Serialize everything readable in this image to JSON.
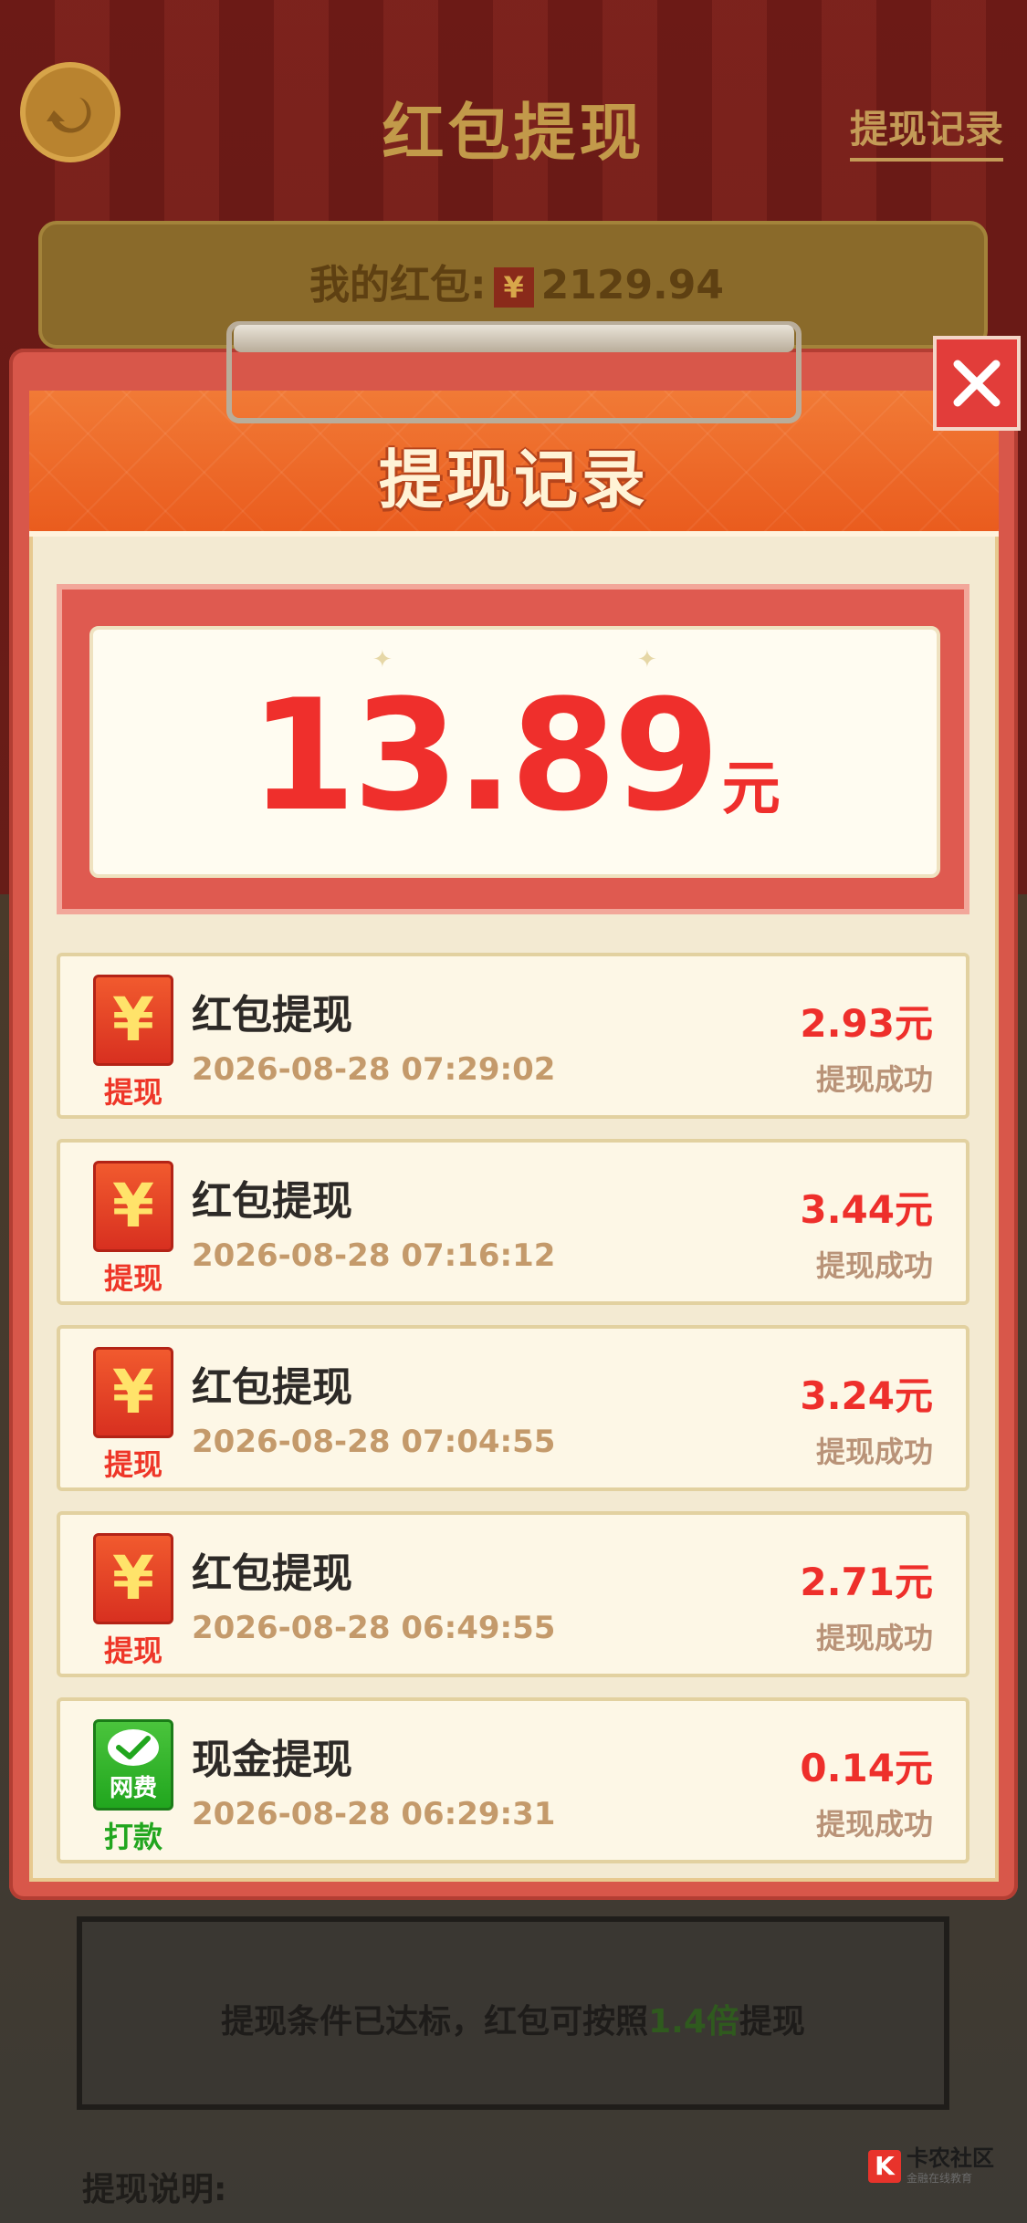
{
  "header": {
    "title": "红包提现",
    "record_link": "提现记录"
  },
  "wallet": {
    "label": "我的红包:",
    "currency_symbol": "¥",
    "balance": "2129.94"
  },
  "modal": {
    "title": "提现记录",
    "total": {
      "amount": "13.89",
      "unit": "元"
    },
    "records": [
      {
        "icon": "yen-icon",
        "caption": "提现",
        "title": "红包提现",
        "time": "2026-08-28 07:29:02",
        "amount": "2.93元",
        "status": "提现成功"
      },
      {
        "icon": "yen-icon",
        "caption": "提现",
        "title": "红包提现",
        "time": "2026-08-28 07:16:12",
        "amount": "3.44元",
        "status": "提现成功"
      },
      {
        "icon": "yen-icon",
        "caption": "提现",
        "title": "红包提现",
        "time": "2026-08-28 07:04:55",
        "amount": "3.24元",
        "status": "提现成功"
      },
      {
        "icon": "yen-icon",
        "caption": "提现",
        "title": "红包提现",
        "time": "2026-08-28 06:49:55",
        "amount": "2.71元",
        "status": "提现成功"
      },
      {
        "icon": "wechat-check-icon",
        "icon_label": "网费",
        "caption": "打款",
        "title": "现金提现",
        "time": "2026-08-28 06:29:31",
        "amount": "0.14元",
        "status": "提现成功"
      }
    ]
  },
  "notice": {
    "text_before": "提现条件已达标，红包可按照",
    "highlight": "1.4倍",
    "text_after": "提现"
  },
  "explain_label": "提现说明:",
  "watermark": {
    "name": "卡农社区",
    "sub": "金融在线教育"
  },
  "colors": {
    "accent_red": "#ee2f2b",
    "header_orange": "#ea5c1e",
    "success_text": "#b99378",
    "green": "#21a61e",
    "highlight_green": "#2f5a1e"
  }
}
